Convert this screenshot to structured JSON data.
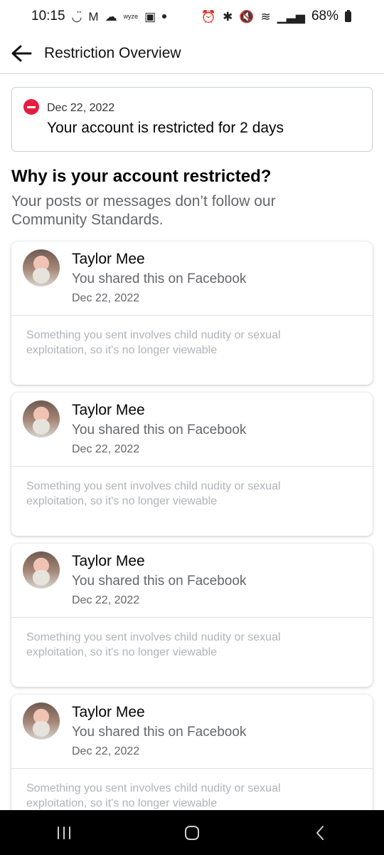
{
  "status_bar": {
    "time": "10:15",
    "battery": "68%",
    "left_icons": [
      "face-icon",
      "gmail-icon",
      "cloud-icon",
      "wyze-icon",
      "gallery-icon",
      "dot-icon"
    ],
    "right_icons": [
      "alarm-icon",
      "bluetooth-icon",
      "mute-icon",
      "wifi-icon",
      "signal-icon",
      "battery-icon"
    ]
  },
  "header": {
    "title": "Restriction Overview",
    "back_icon": "arrow-left-icon"
  },
  "banner": {
    "date": "Dec 22, 2022",
    "message": "Your account is restricted for 2 days",
    "icon": "restriction-icon",
    "icon_color": "#e41e3f"
  },
  "section": {
    "heading": "Why is your account restricted?",
    "description": "Your posts or messages don’t follow our Community Standards."
  },
  "posts": [
    {
      "name": "Taylor Mee",
      "subtitle": "You shared this on Facebook",
      "date": "Dec 22, 2022",
      "notice": "Something you sent involves child nudity or sexual exploitation, so it's no longer viewable"
    },
    {
      "name": "Taylor Mee",
      "subtitle": "You shared this on Facebook",
      "date": "Dec 22, 2022",
      "notice": "Something you sent involves child nudity or sexual exploitation, so it's no longer viewable"
    },
    {
      "name": "Taylor Mee",
      "subtitle": "You shared this on Facebook",
      "date": "Dec 22, 2022",
      "notice": "Something you sent involves child nudity or sexual exploitation, so it's no longer viewable"
    },
    {
      "name": "Taylor Mee",
      "subtitle": "You shared this on Facebook",
      "date": "Dec 22, 2022",
      "notice": "Something you sent involves child nudity or sexual exploitation, so it's no longer viewable"
    }
  ],
  "nav_bar": {
    "buttons": [
      "recent-apps-icon",
      "home-icon",
      "back-icon"
    ]
  }
}
